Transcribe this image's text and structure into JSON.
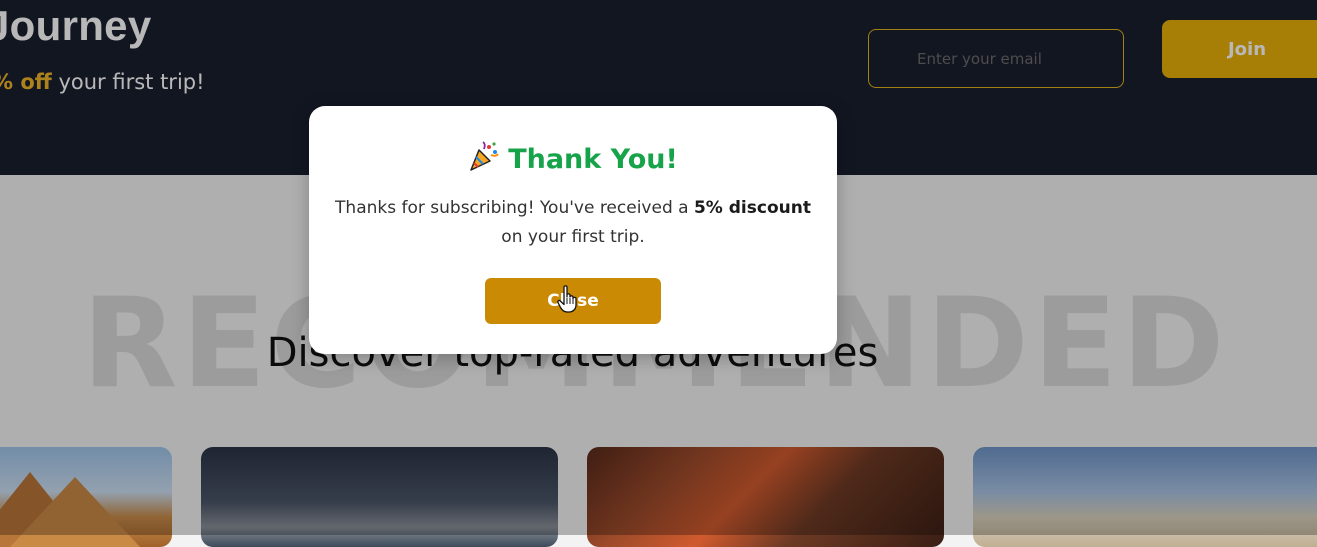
{
  "hero": {
    "title": "Journey",
    "subtitle_accent": "% off",
    "subtitle_rest": " your first trip!"
  },
  "subscribe": {
    "email_placeholder": "Enter your email",
    "join_label": "Join"
  },
  "section": {
    "ghost_text": "RECOMMENDED",
    "title": "Discover top-rated adventures"
  },
  "modal": {
    "title": "Thank You!",
    "text_before": "Thanks for subscribing! You've received a ",
    "text_bold": "5% discount",
    "text_after": " on your first trip.",
    "close_label": "Close"
  },
  "colors": {
    "hero_bg": "#1a1f2e",
    "accent": "#e8b10b",
    "success": "#16a34a",
    "close_button": "#ca8a04"
  },
  "icons": [
    "party-popper-icon",
    "hand-pointer-cursor-icon"
  ]
}
